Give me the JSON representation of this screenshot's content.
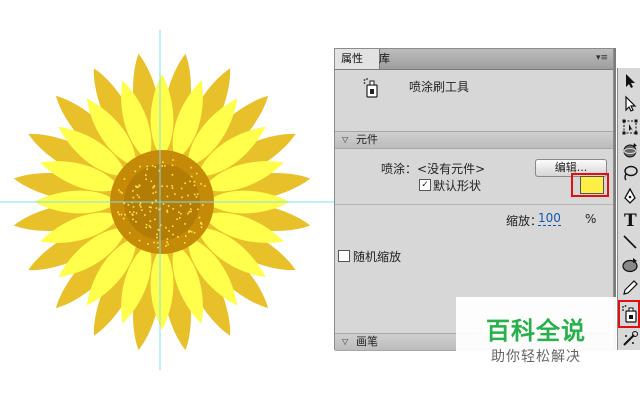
{
  "panel": {
    "tabs": [
      {
        "label": "属性",
        "active": true
      },
      {
        "label": "库",
        "active": false
      }
    ],
    "menu_icon": "panel-menu-icon",
    "tool_name": "喷涂刷工具",
    "sections": {
      "symbol": {
        "label": "元件",
        "spray_label": "喷涂：",
        "spray_value": "<没有元件>",
        "edit_button": "编辑...",
        "default_shape": {
          "label": "默认形状",
          "checked": true
        },
        "color": "#ffee44",
        "scale_label": "缩放：",
        "scale_value": "100",
        "scale_unit": "%"
      },
      "random": {
        "label": "随机缩放",
        "checked": false
      },
      "brush": {
        "label": "画笔"
      }
    }
  },
  "toolbar": {
    "tools": [
      "selection-tool-icon",
      "subselection-tool-icon",
      "free-transform-tool-icon",
      "3d-rotation-tool-icon",
      "lasso-tool-icon",
      "pen-tool-icon",
      "text-tool-icon",
      "line-tool-icon",
      "oval-tool-icon",
      "pencil-tool-icon",
      "spray-brush-tool-icon",
      "deco-tool-icon"
    ],
    "active_tool": "spray-brush-tool-icon"
  },
  "watermark": {
    "title": "百科全说",
    "subtitle": "助你轻松解决"
  },
  "colors": {
    "petal_dark": "#e8c12a",
    "petal_light": "#ffff4c",
    "center_outer": "#c58a07",
    "center_inner": "#b27c05",
    "guide": "#7fe0f0",
    "highlight": "#e01010",
    "watermark_green": "#28b04a"
  }
}
